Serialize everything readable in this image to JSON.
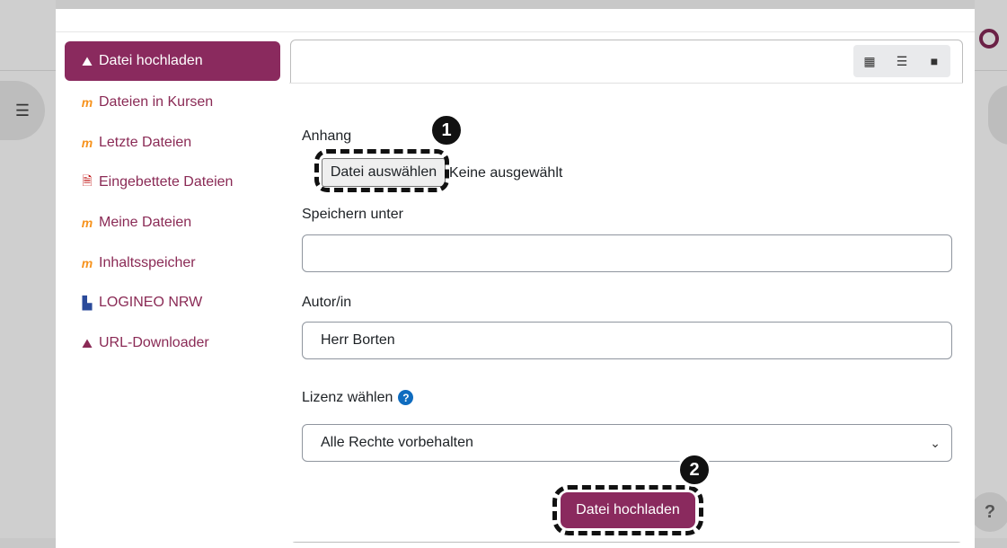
{
  "sidebar": {
    "items": [
      {
        "label": "Datei hochladen",
        "icon": "upload-icon",
        "active": true
      },
      {
        "label": "Dateien in Kursen",
        "icon": "moodle-icon"
      },
      {
        "label": "Letzte Dateien",
        "icon": "moodle-icon"
      },
      {
        "label": "Eingebettete Dateien",
        "icon": "embedded-file-icon"
      },
      {
        "label": "Meine Dateien",
        "icon": "moodle-icon"
      },
      {
        "label": "Inhaltsspeicher",
        "icon": "moodle-icon"
      },
      {
        "label": "LOGINEO NRW",
        "icon": "logineo-icon"
      },
      {
        "label": "URL-Downloader",
        "icon": "url-download-icon"
      }
    ]
  },
  "form": {
    "attachment_label": "Anhang",
    "choose_file_button": "Datei auswählen",
    "no_file_text": "Keine ausgewählt",
    "save_as_label": "Speichern unter",
    "save_as_value": "",
    "author_label": "Autor/in",
    "author_value": "Herr Borten",
    "license_label": "Lizenz wählen",
    "license_value": "Alle Rechte vorbehalten",
    "submit_label": "Datei hochladen"
  },
  "annotations": {
    "step1": "1",
    "step2": "2"
  },
  "help_badge": "?",
  "colors": {
    "accent": "#8a2a5e",
    "link": "#8a2a55",
    "help_icon": "#0f6cbf"
  }
}
